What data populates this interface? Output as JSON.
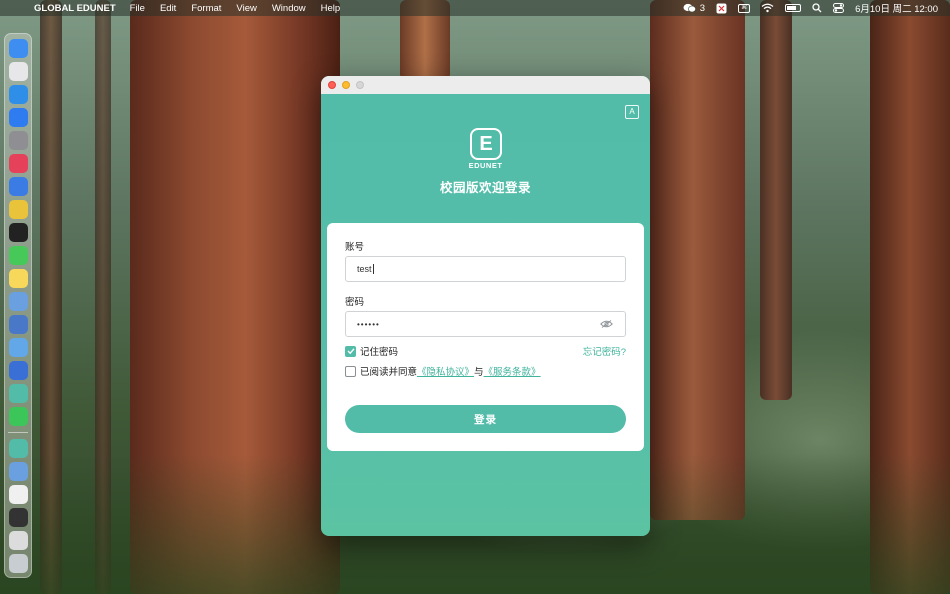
{
  "menubar": {
    "apple_glyph": "",
    "app_name": "GLOBAL EDUNET",
    "menus": [
      "File",
      "Edit",
      "Format",
      "View",
      "Window",
      "Help"
    ],
    "wechat_badge": "3",
    "datetime": "6月10日 周二  12:00",
    "status_icons": [
      "wechat-icon",
      "notes-icon",
      "keyboard-icon",
      "wifi-icon",
      "battery-icon",
      "search-icon",
      "control-center-icon"
    ]
  },
  "dock": {
    "items": [
      {
        "name": "finder",
        "color": "#3d8ef0"
      },
      {
        "name": "launchpad",
        "color": "#e7e7ea"
      },
      {
        "name": "safari",
        "color": "#2f8fe8"
      },
      {
        "name": "app-store",
        "color": "#2e7cf0"
      },
      {
        "name": "system-settings",
        "color": "#8e8e93"
      },
      {
        "name": "mail-flag",
        "color": "#e6415a"
      },
      {
        "name": "xcode",
        "color": "#3b7ce4"
      },
      {
        "name": "chrome",
        "color": "#e9c43a"
      },
      {
        "name": "terminal",
        "color": "#222222"
      },
      {
        "name": "messages",
        "color": "#47c95a"
      },
      {
        "name": "notes",
        "color": "#f7d85a"
      },
      {
        "name": "preview",
        "color": "#6aa0e0"
      },
      {
        "name": "remote-desktop",
        "color": "#4a78c8"
      },
      {
        "name": "finder-2",
        "color": "#62a8e8"
      },
      {
        "name": "simulator",
        "color": "#3a6fd6"
      },
      {
        "name": "edunet",
        "color": "#52bca9"
      },
      {
        "name": "wechat",
        "color": "#3cc659"
      }
    ],
    "recent_items": [
      {
        "name": "edunet-recent",
        "color": "#52bca9"
      },
      {
        "name": "preview-recent",
        "color": "#6aa0e0"
      },
      {
        "name": "document-recent",
        "color": "#f0f0f0"
      },
      {
        "name": "screenshot-recent",
        "color": "#333333"
      },
      {
        "name": "downloads-recent",
        "color": "#dcdcdc"
      },
      {
        "name": "trash",
        "color": "#c8cdd1"
      }
    ]
  },
  "window": {
    "logo_letter": "E",
    "logo_text": "EDUNET",
    "translate_icon_text": "A",
    "welcome_title": "校园版欢迎登录",
    "account_label": "账号",
    "account_value": "test",
    "password_label": "密码",
    "password_value": "••••••",
    "remember_label": "记住密码",
    "remember_checked": true,
    "forgot_link": "忘记密码?",
    "agree_prefix": "已阅读并同意",
    "privacy_link": "《隐私协议》",
    "agree_and": "与",
    "terms_link": "《服务条款》",
    "agree_checked": false,
    "login_button": "登录",
    "accent_color": "#52bca9"
  }
}
